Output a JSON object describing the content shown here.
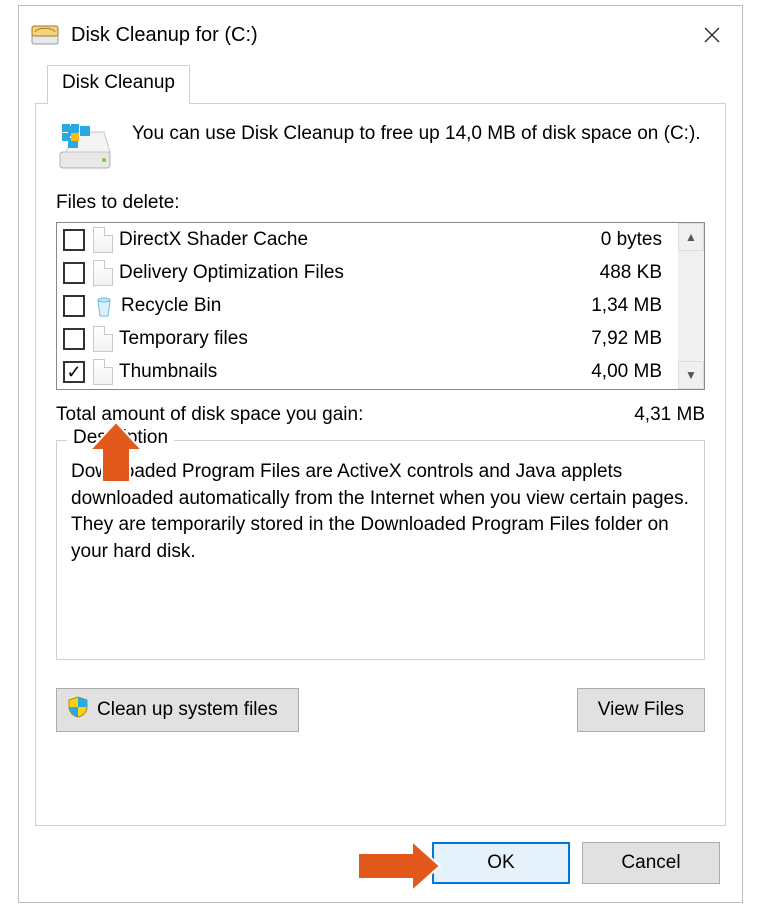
{
  "title": "Disk Cleanup for  (C:)",
  "tab": "Disk Cleanup",
  "info": "You can use Disk Cleanup to free up 14,0 MB of disk space on  (C:).",
  "files_label": "Files to delete:",
  "items": [
    {
      "name": "DirectX Shader Cache",
      "size": "0 bytes",
      "checked": false,
      "icon": "file"
    },
    {
      "name": "Delivery Optimization Files",
      "size": "488 KB",
      "checked": false,
      "icon": "file"
    },
    {
      "name": "Recycle Bin",
      "size": "1,34 MB",
      "checked": false,
      "icon": "recycle"
    },
    {
      "name": "Temporary files",
      "size": "7,92 MB",
      "checked": false,
      "icon": "file"
    },
    {
      "name": "Thumbnails",
      "size": "4,00 MB",
      "checked": true,
      "icon": "file"
    }
  ],
  "total_label": "Total amount of disk space you gain:",
  "total_value": "4,31 MB",
  "desc_legend": "Description",
  "desc_text": "Downloaded Program Files are ActiveX controls and Java applets downloaded automatically from the Internet when you view certain pages. They are temporarily stored in the Downloaded Program Files folder on your hard disk.",
  "cleanup_btn": "Clean up system files",
  "viewfiles_btn": "View Files",
  "ok_btn": "OK",
  "cancel_btn": "Cancel"
}
